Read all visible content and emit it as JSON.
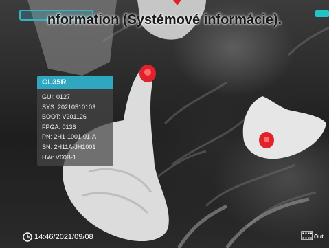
{
  "overlay_title": "nformation (Systémové informácie).",
  "device_info": {
    "header": "GL35R",
    "lines": [
      "GUI: 0127",
      "SYS: 20210510103",
      "BOOT: V201126",
      "FPGA: 0136",
      "PN: 2H1-1001-01-A",
      "SN: 2H11A-JH1001",
      "HW: V60B-1"
    ]
  },
  "status_bar": {
    "timestamp": "14:46/2021/09/08",
    "output_label": "Out"
  },
  "icons": {
    "clock": "clock-icon",
    "video_output": "video-output-icon",
    "battery": "battery-icon"
  },
  "colors": {
    "accent": "#2fa7c0",
    "hotspot": "#e0222a",
    "panel_bg": "#464646"
  }
}
